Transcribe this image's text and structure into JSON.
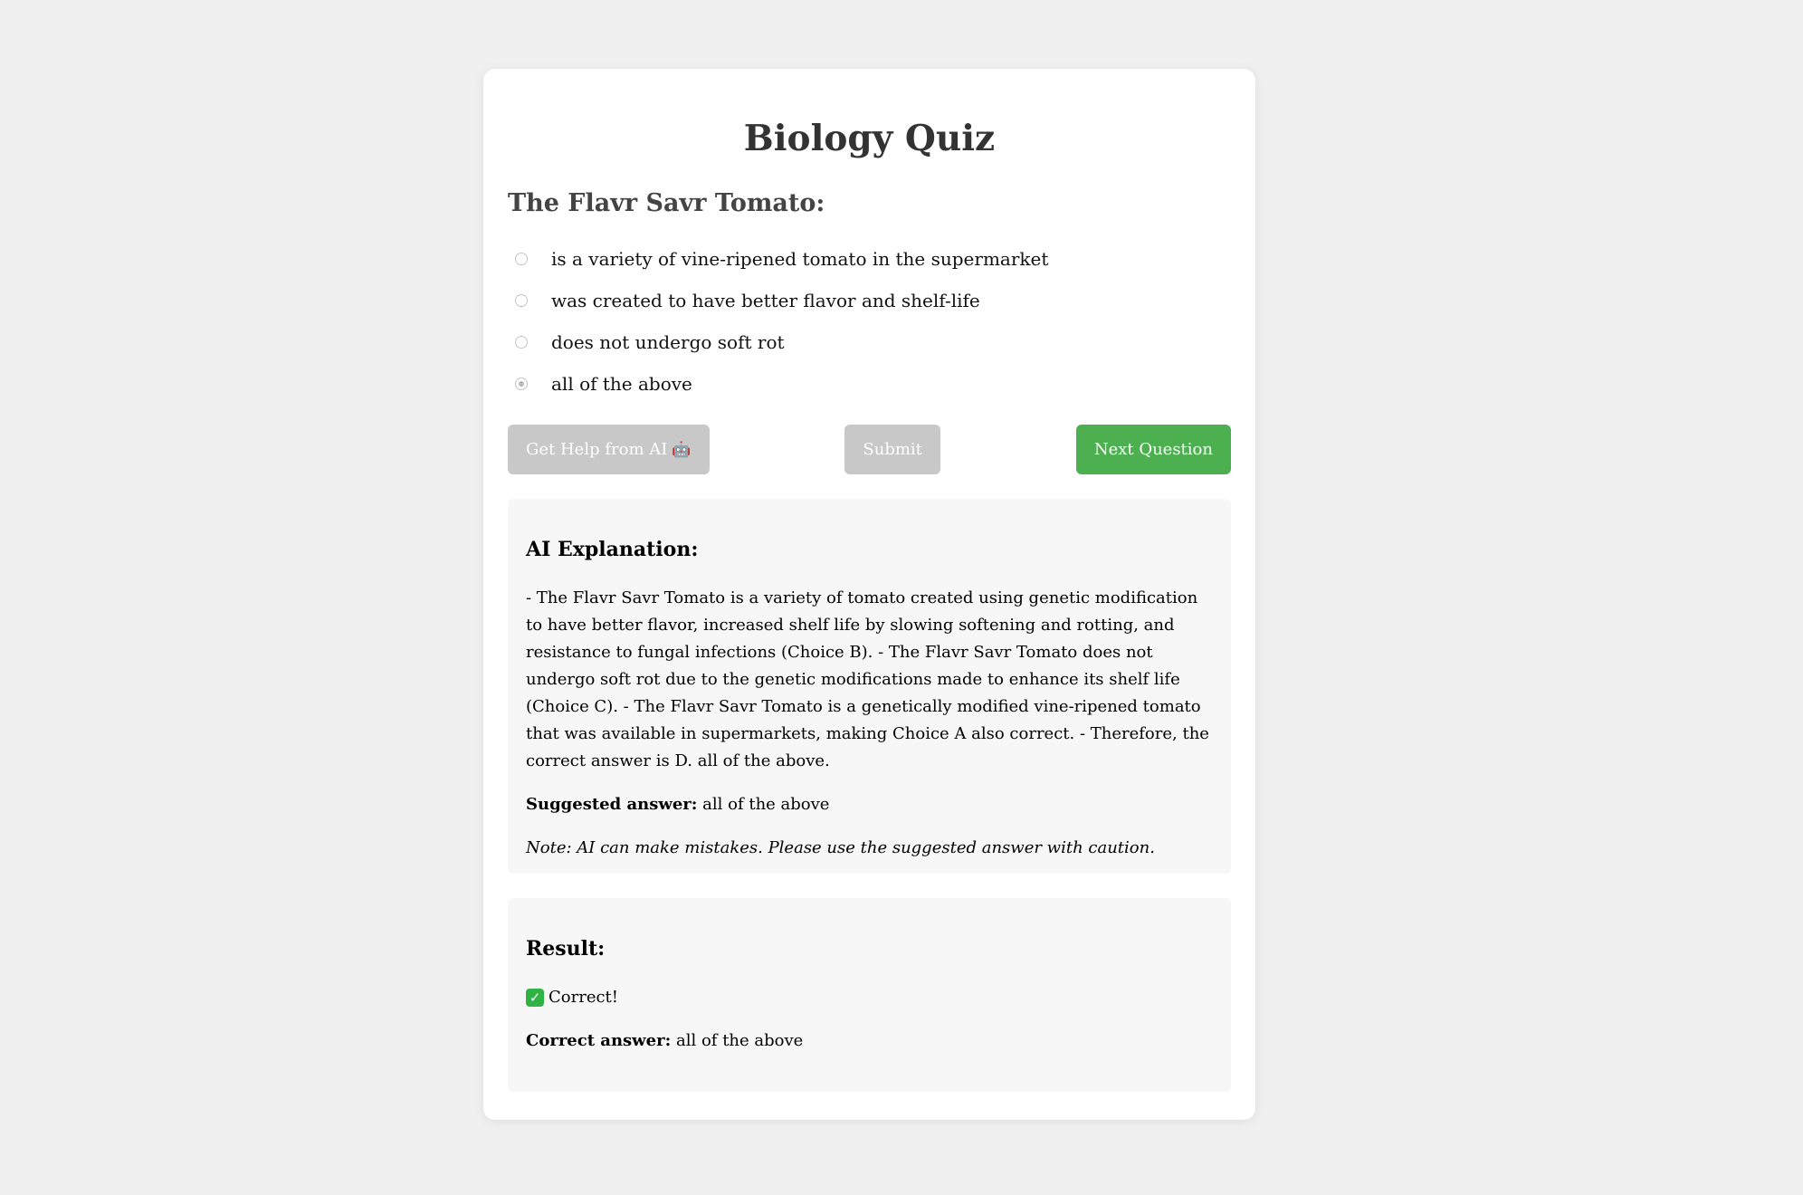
{
  "quiz": {
    "title": "Biology Quiz",
    "question": "The Flavr Savr Tomato:",
    "options": [
      {
        "label": "is a variety of vine-ripened tomato in the supermarket",
        "selected": false
      },
      {
        "label": "was created to have better flavor and shelf-life",
        "selected": false
      },
      {
        "label": "does not undergo soft rot",
        "selected": false
      },
      {
        "label": "all of the above",
        "selected": true
      }
    ]
  },
  "buttons": {
    "help_label": "Get Help from AI",
    "help_icon": "robot-icon",
    "submit_label": "Submit",
    "next_label": "Next Question"
  },
  "colors": {
    "background": "#f0f0f0",
    "card": "#ffffff",
    "disabled_button": "#c8c8c8",
    "primary_button": "#4caf50",
    "panel": "#f7f7f7",
    "correct_check": "#2fb344"
  },
  "explanation": {
    "heading": "AI Explanation:",
    "text": "- The Flavr Savr Tomato is a variety of tomato created using genetic modification to have better flavor, increased shelf life by slowing softening and rotting, and resistance to fungal infections (Choice B). - The Flavr Savr Tomato does not undergo soft rot due to the genetic modifications made to enhance its shelf life (Choice C). - The Flavr Savr Tomato is a genetically modified vine-ripened tomato that was available in supermarkets, making Choice A also correct. - Therefore, the correct answer is D. all of the above.",
    "suggested_label": "Suggested answer:",
    "suggested_value": "all of the above",
    "note": "Note: AI can make mistakes. Please use the suggested answer with caution."
  },
  "result": {
    "heading": "Result:",
    "status_icon": "check-mark-icon",
    "status_text": "Correct!",
    "answer_label": "Correct answer:",
    "answer_value": "all of the above"
  }
}
